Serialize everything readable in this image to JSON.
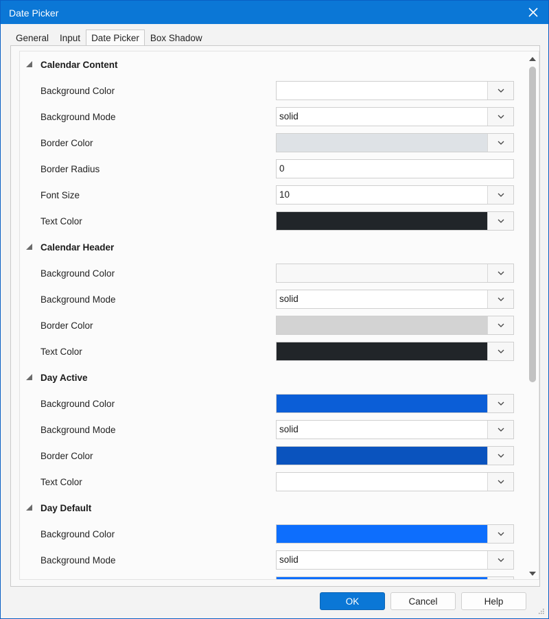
{
  "window": {
    "title": "Date Picker"
  },
  "tabs": [
    {
      "label": "General"
    },
    {
      "label": "Input"
    },
    {
      "label": "Date Picker",
      "active": true
    },
    {
      "label": "Box Shadow"
    }
  ],
  "sections": [
    {
      "title": "Calendar Content",
      "props": [
        {
          "label": "Background Color",
          "value": "",
          "color": "#ffffff",
          "has_dropdown": true
        },
        {
          "label": "Background Mode",
          "value": "solid",
          "has_dropdown": true
        },
        {
          "label": "Border Color",
          "value": "",
          "color": "#dee2e6",
          "has_dropdown": true
        },
        {
          "label": "Border Radius",
          "value": "0",
          "has_dropdown": false
        },
        {
          "label": "Font Size",
          "value": "10",
          "has_dropdown": true
        },
        {
          "label": "Text Color",
          "value": "",
          "color": "#212529",
          "has_dropdown": true
        }
      ]
    },
    {
      "title": "Calendar Header",
      "props": [
        {
          "label": "Background Color",
          "value": "",
          "color": "#f8f8f8",
          "has_dropdown": true
        },
        {
          "label": "Background Mode",
          "value": "solid",
          "has_dropdown": true
        },
        {
          "label": "Border Color",
          "value": "",
          "color": "#d3d3d3",
          "has_dropdown": true
        },
        {
          "label": "Text Color",
          "value": "",
          "color": "#212529",
          "has_dropdown": true
        }
      ]
    },
    {
      "title": "Day Active",
      "props": [
        {
          "label": "Background Color",
          "value": "",
          "color": "#0b5ed7",
          "has_dropdown": true
        },
        {
          "label": "Background Mode",
          "value": "solid",
          "has_dropdown": true
        },
        {
          "label": "Border Color",
          "value": "",
          "color": "#0a53be",
          "has_dropdown": true
        },
        {
          "label": "Text Color",
          "value": "",
          "color": "#ffffff",
          "has_dropdown": true
        }
      ]
    },
    {
      "title": "Day Default",
      "props": [
        {
          "label": "Background Color",
          "value": "",
          "color": "#0d6efd",
          "has_dropdown": true
        },
        {
          "label": "Background Mode",
          "value": "solid",
          "has_dropdown": true
        },
        {
          "label": "",
          "value": "",
          "color": "#0d6efd",
          "has_dropdown": true
        }
      ]
    }
  ],
  "buttons": {
    "ok": "OK",
    "cancel": "Cancel",
    "help": "Help"
  },
  "colors": {
    "accent": "#0b77d6",
    "panel": "#f9f9f9"
  }
}
